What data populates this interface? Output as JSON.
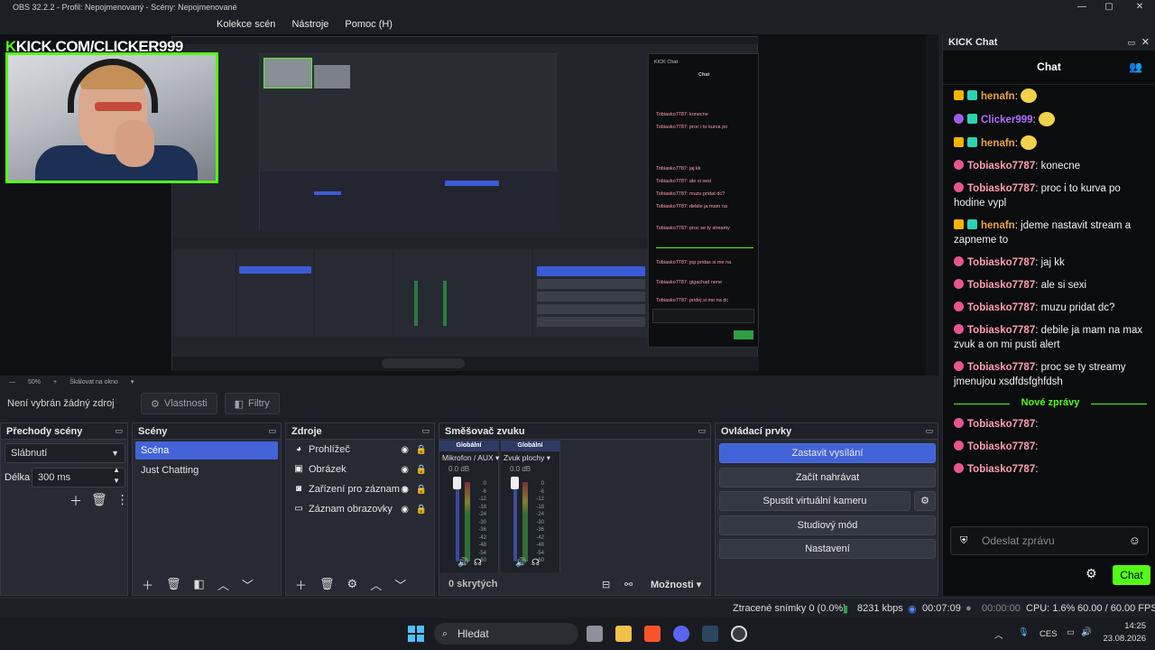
{
  "window": {
    "title": "OBS 32.2.2 - Profil: Nepojmenovaný - Scény: Nepojmenované"
  },
  "menu": [
    "Kolekce scén",
    "Nástroje",
    "Pomoc (H)"
  ],
  "overlay": {
    "kick_label": "KICK.COM/CLICKER999"
  },
  "zoom": {
    "value": "50%",
    "scale_label": "Škálovat na okno"
  },
  "source_toolbar": {
    "none_selected": "Není vybrán žádný zdroj",
    "properties": "Vlastnosti",
    "filters": "Filtry"
  },
  "docks": {
    "transitions": {
      "title": "Přechody scény",
      "selected": "Slábnutí",
      "duration_label": "Délka",
      "duration_value": "300 ms"
    },
    "scenes": {
      "title": "Scény",
      "items": [
        {
          "label": "Scéna",
          "active": true
        },
        {
          "label": "Just Chatting",
          "active": false
        }
      ]
    },
    "sources": {
      "title": "Zdroje",
      "items": [
        {
          "label": "Prohlížeč",
          "icon": "globe-icon"
        },
        {
          "label": "Obrázek",
          "icon": "image-icon"
        },
        {
          "label": "Zařízení pro záznam o",
          "icon": "camera-icon"
        },
        {
          "label": "Záznam obrazovky",
          "icon": "monitor-icon"
        }
      ]
    },
    "mixer": {
      "title": "Směšovač zvuku",
      "channels": [
        {
          "group": "Globální",
          "name": "Mikrofon / AUX",
          "db": "0.0 dB",
          "fader_level": 0.95
        },
        {
          "group": "Globální",
          "name": "Zvuk plochy",
          "db": "0.0 dB",
          "fader_level": 0.95
        }
      ],
      "scale": [
        "0",
        "-6",
        "-12",
        "-18",
        "-24",
        "-30",
        "-36",
        "-42",
        "-48",
        "-54",
        "-60"
      ],
      "hidden": "0 skrytých",
      "options": "Možnosti"
    },
    "controls": {
      "title": "Ovládací prvky",
      "stop_stream": "Zastavit vysílání",
      "start_record": "Začít nahrávat",
      "virtual_cam": "Spustit virtuální kameru",
      "studio": "Studiový mód",
      "settings": "Nastavení"
    }
  },
  "chat": {
    "dock_title": "KICK Chat",
    "header": "Chat",
    "messages": [
      {
        "badges": [
          "crown",
          "sub"
        ],
        "user": "henafn",
        "color": "#e8a34a",
        "text": "",
        "emote": true
      },
      {
        "badges": [
          "mic",
          "sub-mic"
        ],
        "user": "Clicker999",
        "color": "#b26cff",
        "text": "",
        "emote": true
      },
      {
        "badges": [
          "crown",
          "sub"
        ],
        "user": "henafn",
        "color": "#e8a34a",
        "text": "",
        "emote": true
      },
      {
        "badges": [
          "pink"
        ],
        "user": "Tobiasko7787",
        "color": "#ff9eb4",
        "text": "konecne"
      },
      {
        "badges": [
          "pink"
        ],
        "user": "Tobiasko7787",
        "color": "#ff9eb4",
        "text": "proc i to kurva po hodine vypl"
      },
      {
        "badges": [
          "crown",
          "sub"
        ],
        "user": "henafn",
        "color": "#e8a34a",
        "text": "jdeme nastavit stream a zapneme to"
      },
      {
        "badges": [
          "pink"
        ],
        "user": "Tobiasko7787",
        "color": "#ff9eb4",
        "text": "jaj kk"
      },
      {
        "badges": [
          "pink"
        ],
        "user": "Tobiasko7787",
        "color": "#ff9eb4",
        "text": "ale si sexi"
      },
      {
        "badges": [
          "pink"
        ],
        "user": "Tobiasko7787",
        "color": "#ff9eb4",
        "text": "muzu pridat dc?"
      },
      {
        "badges": [
          "pink"
        ],
        "user": "Tobiasko7787",
        "color": "#ff9eb4",
        "text": "debile ja mam na max zvuk a on mi pusti alert"
      },
      {
        "badges": [
          "pink"
        ],
        "user": "Tobiasko7787",
        "color": "#ff9eb4",
        "text": "proc se ty streamy jmenujou xsdfdsfghfdsh"
      }
    ],
    "new_messages_label": "Nové zprávy",
    "new_messages": [
      {
        "user": "Tobiasko7787",
        "text": "jop pridas si me na dc"
      },
      {
        "user": "Tobiasko7787",
        "text": "gigachad nene aknechad"
      },
      {
        "user": "Tobiasko7787",
        "text": "pridej si me na dc"
      }
    ],
    "input_placeholder": "Odeslat zprávu",
    "send_label": "Chat",
    "colors": {
      "accent": "#53fc18"
    }
  },
  "status": {
    "dropped": "Ztracené snímky 0 (0.0%)",
    "bitrate": "8231 kbps",
    "stream_time": "00:07:09",
    "rec_time": "00:00:00",
    "cpu": "CPU: 1.6%",
    "fps": "60.00 / 60.00 FPS"
  },
  "taskbar": {
    "search": "Hledat",
    "lang": "CES",
    "time": "14:25",
    "date": "23.08.2026"
  }
}
